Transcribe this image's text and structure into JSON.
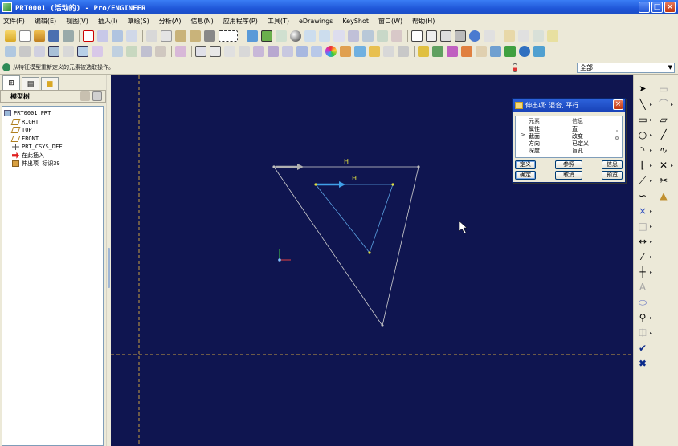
{
  "window": {
    "title": "PRT0001 (活动的) - Pro/ENGINEER",
    "buttons": {
      "minimize": "_",
      "maximize": "□",
      "close": "×"
    }
  },
  "menubar": {
    "items": [
      "文件(F)",
      "编辑(E)",
      "视图(V)",
      "插入(I)",
      "草绘(S)",
      "分析(A)",
      "信息(N)",
      "应用程序(P)",
      "工具(T)",
      "eDrawings",
      "KeyShot",
      "窗口(W)",
      "帮助(H)"
    ]
  },
  "statusline": {
    "message": "从特征模型重新定义的元素被选取操作。",
    "filter_value": "全部"
  },
  "navigator": {
    "header": "模型树",
    "tree": [
      {
        "label": "PRT0001.PRT",
        "icon": "part-icon",
        "indent": 0
      },
      {
        "label": "RIGHT",
        "icon": "datum-plane-icon",
        "indent": 1
      },
      {
        "label": "TOP",
        "icon": "datum-plane-icon",
        "indent": 1
      },
      {
        "label": "FRONT",
        "icon": "datum-plane-icon",
        "indent": 1
      },
      {
        "label": "PRT_CSYS_DEF",
        "icon": "csys-icon",
        "indent": 1
      },
      {
        "label": "在此插入",
        "icon": "insert-here-icon",
        "indent": 1
      },
      {
        "label": "伸出项 标识39",
        "icon": "protrusion-icon",
        "indent": 1
      }
    ]
  },
  "graphics": {
    "dimension_labels": [
      "H",
      "H"
    ]
  },
  "dialog": {
    "title": "伸出项: 混合, 平行...",
    "close": "×",
    "columns": [
      "元素",
      "信息"
    ],
    "rows": [
      {
        "element": "属性",
        "info": "直",
        "marker": ""
      },
      {
        "element": "截面",
        "info": "改变",
        "marker": ">"
      },
      {
        "element": "方向",
        "info": "已定义",
        "marker": ""
      },
      {
        "element": "深度",
        "info": "盲孔",
        "marker": ""
      }
    ],
    "buttons_row1": [
      "定义",
      "参照",
      "信息"
    ],
    "buttons_row2": [
      "确定",
      "取消",
      "预览"
    ]
  },
  "colors": {
    "graphics_bg": "#0f1550",
    "centerline": "#c8a040",
    "section_outer": "#d0d0d0",
    "section_inner": "#5aa0e0",
    "vertex": "#e0e040"
  }
}
